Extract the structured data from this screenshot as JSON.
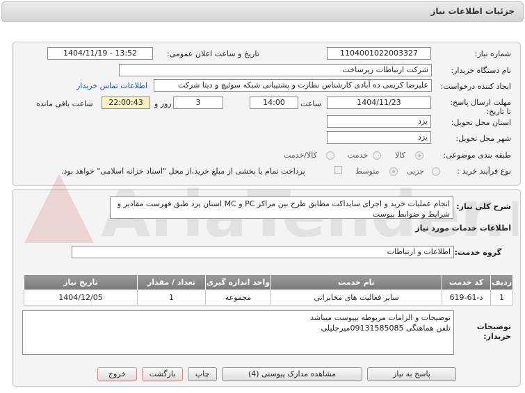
{
  "header": {
    "title": "جزئیات اطلاعات نیاز"
  },
  "form": {
    "need_number_label": "شماره نیاز:",
    "need_number": "1104001022003327",
    "announce_label": "تاریخ و ساعت اعلان عمومی:",
    "announce_value": "1404/11/19 - 13:52",
    "buyer_org_label": "نام دستگاه خریدار:",
    "buyer_org": "شرکت ارتباطات زیرساخت",
    "creator_label": "ایجاد کننده درخواست:",
    "creator": "علیرضا کریمی ده آبادی کارشناس نظارت و پشتیبانی شبکه سوئیچ و دیتا شرکت",
    "contact_link": "اطلاعات تماس خریدار",
    "deadline_label": "مهلت ارسال پاسخ: تا تاریخ:",
    "deadline_date": "1404/11/23",
    "time_label": "ساعت",
    "deadline_time": "14:00",
    "days_value": "3",
    "days_label": "روز و",
    "remaining_time": "22:00:43",
    "remaining_label": "ساعت باقی مانده",
    "province_label": "استان محل تحویل:",
    "province": "یزد",
    "city_label": "شهر محل تحویل:",
    "city": "یزد",
    "category_label": "طبقه بندی موضوعی:",
    "category_options": [
      "کالا",
      "خدمت",
      "کالا/خدمت"
    ],
    "process_label": "نوع فرآیند خرید :",
    "process_options": [
      "جزیی",
      "متوسط"
    ],
    "payment_note": "پرداخت تمام یا بخشی از مبلغ خرید،از محل \"اسناد خزانه اسلامی\" خواهد بود."
  },
  "summary": {
    "label": "شرح کلی نیاز:",
    "text": "انجام عملیات خرید و اجرای سایداکت مطابق طرح بین مراکز PC و MC استان یزد طبق فهرست مقادیر و شرایط و ضوابط پیوست"
  },
  "services": {
    "section_title": "اطلاعات خدمات مورد نیاز",
    "group_label": "گروه خدمت:",
    "group_value": "اطلاعات و ارتباطات",
    "columns": [
      "ردیف",
      "کد خدمت",
      "نام خدمت",
      "واحد اندازه گیری",
      "تعداد / مقدار",
      "تاریخ نیاز"
    ],
    "rows": [
      [
        "1",
        "د-61-619",
        "سایر فعالیت های مخابراتی",
        "مجموعه",
        "1",
        "1404/12/05"
      ]
    ]
  },
  "buyer_notes": {
    "label": "توضیحات خریدار:",
    "line1": "توضیحات و الزامات مربوطه بپیوست میباشد",
    "line2": "تلفن هماهنگی  09131585085میرجلیلی"
  },
  "buttons": {
    "reply": "پاسخ به نیاز",
    "attachments": "مشاهده مدارک پیوستی (4)",
    "print": "چاپ",
    "back": "بازگشت",
    "exit": "خروج"
  },
  "watermark": {
    "text": "AriaTender.net"
  }
}
